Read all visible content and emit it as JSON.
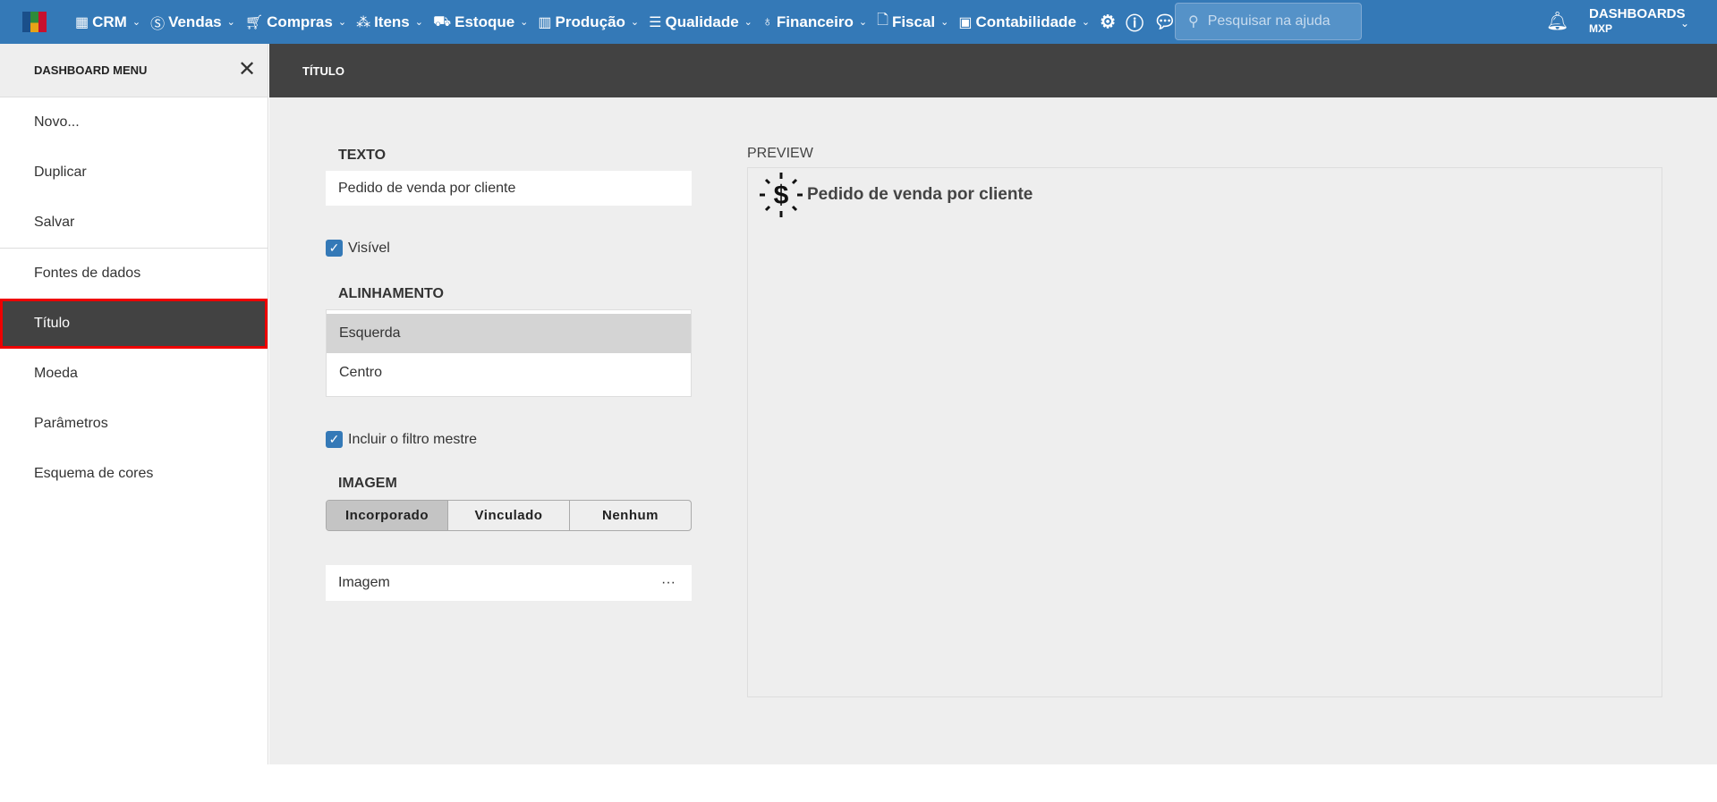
{
  "topnav": {
    "logo_colors": [
      "#1a4f8a",
      "#2e8b3a",
      "#e8a317",
      "#c8102e"
    ],
    "menus": [
      {
        "label": "CRM",
        "icon": "building-icon"
      },
      {
        "label": "Vendas",
        "icon": "dollar-circle-icon"
      },
      {
        "label": "Compras",
        "icon": "cart-icon"
      },
      {
        "label": "Itens",
        "icon": "items-icon"
      },
      {
        "label": "Estoque",
        "icon": "dolly-icon"
      },
      {
        "label": "Produção",
        "icon": "factory-icon"
      },
      {
        "label": "Qualidade",
        "icon": "checklist-icon"
      },
      {
        "label": "Financeiro",
        "icon": "money-bag-icon"
      },
      {
        "label": "Fiscal",
        "icon": "document-check-icon"
      },
      {
        "label": "Contabilidade",
        "icon": "calculator-icon"
      }
    ],
    "search_placeholder": "Pesquisar na ajuda",
    "user_title": "DASHBOARDS",
    "user_sub": "MXP"
  },
  "sidebar": {
    "title": "DASHBOARD MENU",
    "items": [
      "Novo...",
      "Duplicar",
      "Salvar",
      "Fontes de dados",
      "Título",
      "Moeda",
      "Parâmetros",
      "Esquema de cores"
    ]
  },
  "main": {
    "header": "TÍTULO",
    "texto_label": "TEXTO",
    "texto_value": "Pedido de venda por cliente",
    "visivel_label": "Visível",
    "visivel_checked": true,
    "alinhamento_label": "ALINHAMENTO",
    "alinhamento_options": [
      "Esquerda",
      "Centro"
    ],
    "alinhamento_selected": "Esquerda",
    "filtro_label": "Incluir o filtro mestre",
    "filtro_checked": true,
    "imagem_label": "IMAGEM",
    "imagem_options": [
      "Incorporado",
      "Vinculado",
      "Nenhum"
    ],
    "imagem_selected": "Incorporado",
    "imagem_field": "Imagem",
    "imagem_more": "···",
    "preview_label": "PREVIEW",
    "preview_title": "Pedido de venda por cliente"
  }
}
